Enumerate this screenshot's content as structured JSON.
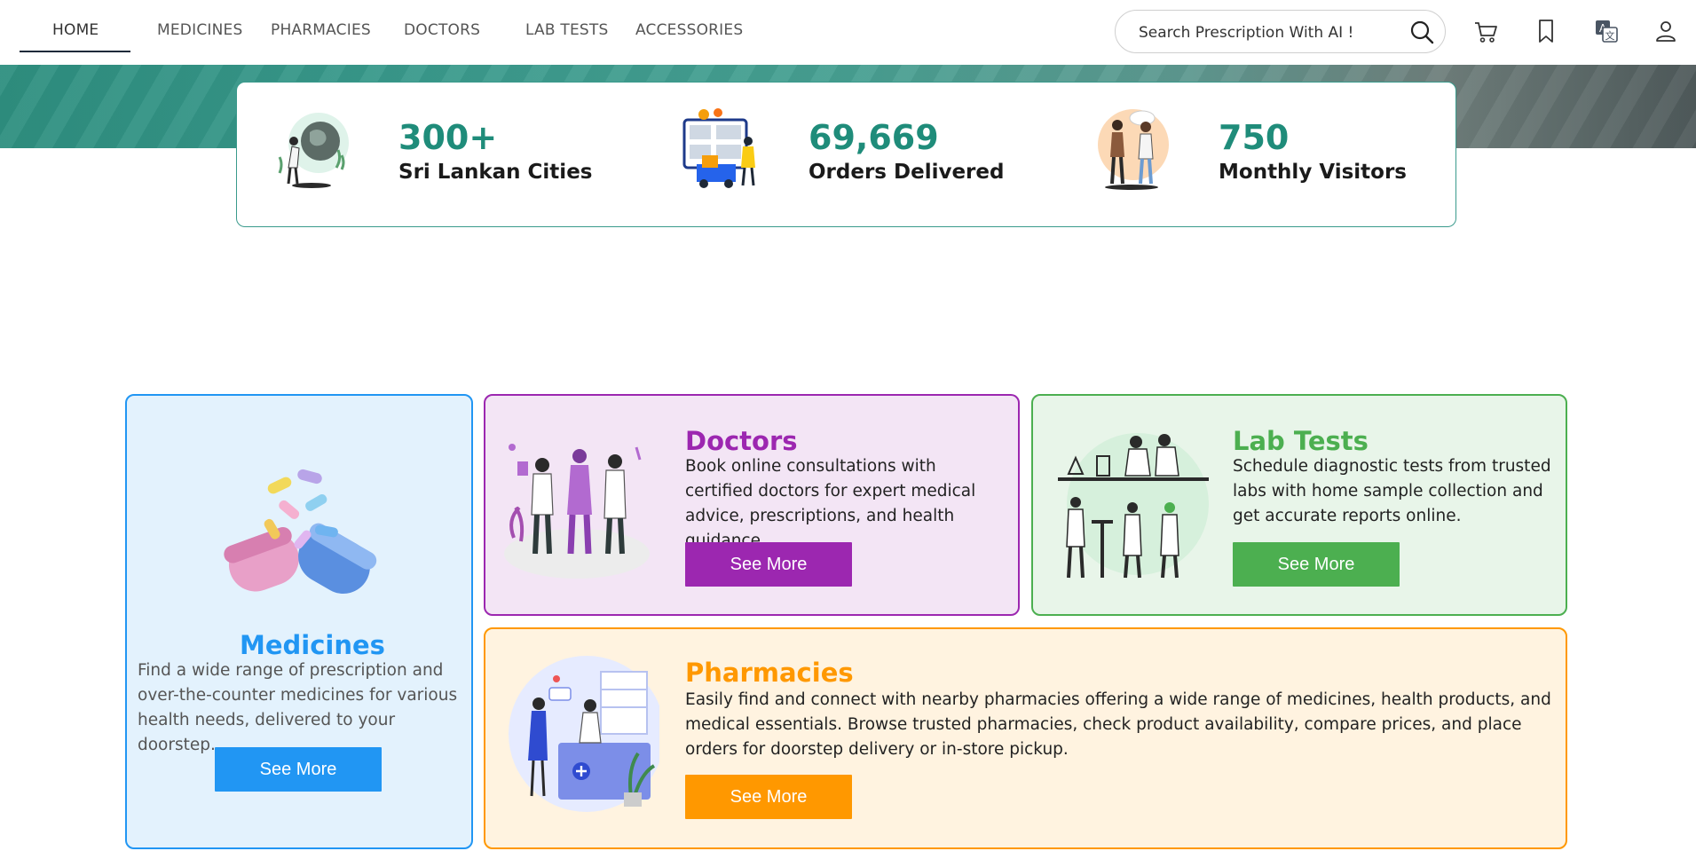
{
  "nav": {
    "items": [
      {
        "label": "HOME",
        "active": true
      },
      {
        "label": "MEDICINES"
      },
      {
        "label": "PHARMACIES"
      },
      {
        "label": "DOCTORS"
      },
      {
        "label": "LAB TESTS"
      },
      {
        "label": "ACCESSORIES"
      }
    ],
    "search_placeholder": "Search Prescription With AI !",
    "icons": [
      "search-icon",
      "cart-icon",
      "bookmark-icon",
      "translate-icon",
      "user-icon"
    ]
  },
  "stats": [
    {
      "number": "300+",
      "label": "Sri Lankan Cities",
      "icon": "globe-person-illustration"
    },
    {
      "number": "69,669",
      "label": "Orders Delivered",
      "icon": "delivery-dashboard-illustration"
    },
    {
      "number": "750",
      "label": "Monthly Visitors",
      "icon": "visitors-illustration"
    }
  ],
  "services": {
    "medicines": {
      "title": "Medicines",
      "description": "Find a wide range of prescription and over-the-counter medicines for various health needs, delivered to your doorstep.",
      "button": "See More",
      "color": "#2196f3"
    },
    "doctors": {
      "title": "Doctors",
      "description": "Book online consultations with certified doctors for expert medical advice, prescriptions, and health guidance.",
      "button": "See More",
      "color": "#9c27b0"
    },
    "lab_tests": {
      "title": "Lab Tests",
      "description": "Schedule diagnostic tests from trusted labs with home sample collection and get accurate reports online.",
      "button": "See More",
      "color": "#4caf50"
    },
    "pharmacies": {
      "title": "Pharmacies",
      "description": "Easily find and connect with nearby pharmacies offering a wide range of medicines, health products, and medical essentials. Browse trusted pharmacies, check product availability, compare prices, and place orders for doorstep delivery or in-store pickup.",
      "button": "See More",
      "color": "#ff9800"
    }
  },
  "colors": {
    "brand_teal": "#1f8c7a",
    "nav_underline": "#1e2a3a"
  }
}
